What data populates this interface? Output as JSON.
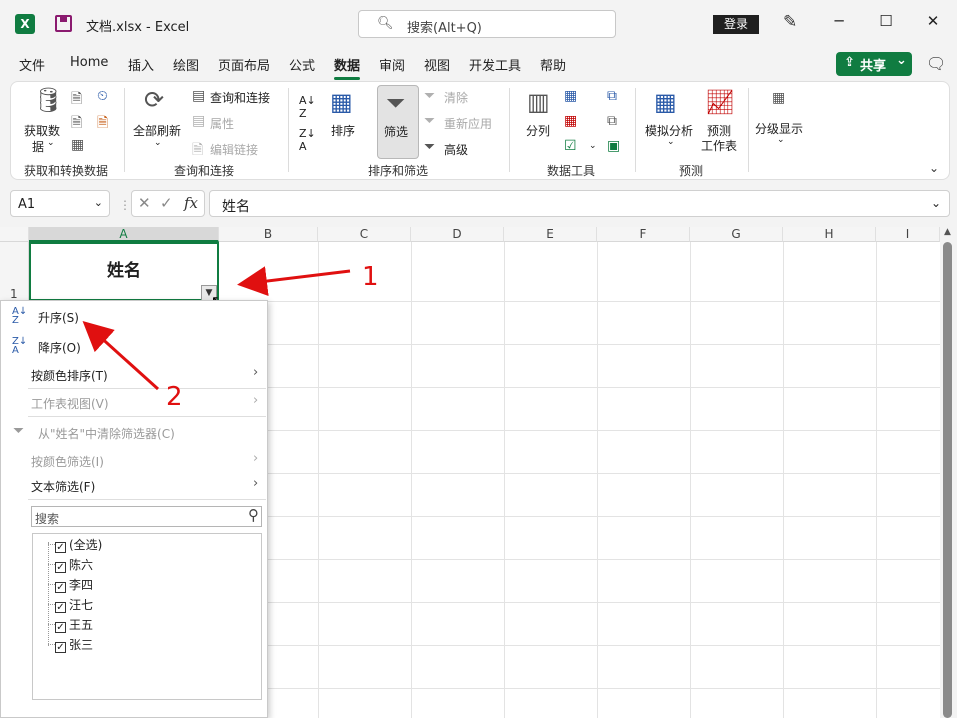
{
  "titlebar": {
    "app_icon": "X",
    "doc_title": "文档.xlsx  -  Excel",
    "search_placeholder": "搜索(Alt+Q)",
    "login": "登录",
    "minimize": "─",
    "maximize": "☐",
    "close": "✕"
  },
  "tabs": [
    "文件",
    "Home",
    "插入",
    "绘图",
    "页面布局",
    "公式",
    "数据",
    "审阅",
    "视图",
    "开发工具",
    "帮助"
  ],
  "share": {
    "label": "共享",
    "icon": "⇪",
    "caret": "⌄"
  },
  "ribbon": {
    "get_data": "获取数",
    "get_data2": "据",
    "refresh_all": "全部刷新",
    "query_conn": "查询和连接",
    "properties": "属性",
    "edit_links": "编辑链接",
    "sort": "排序",
    "filter": "筛选",
    "clear": "清除",
    "reapply": "重新应用",
    "advanced": "高级",
    "split": "分列",
    "whatif": "模拟分析",
    "forecast1": "预测",
    "forecast2": "工作表",
    "outline": "分级显示",
    "groups": {
      "get_transform": "获取和转换数据",
      "queries": "查询和连接",
      "sort_filter": "排序和筛选",
      "data_tools": "数据工具",
      "forecast": "预测"
    }
  },
  "formula_bar": {
    "name_box": "A1",
    "fx": "fx",
    "content": "姓名"
  },
  "grid": {
    "columns": [
      "A",
      "B",
      "C",
      "D",
      "E",
      "F",
      "G",
      "H",
      "I"
    ],
    "row1": "1",
    "a1": "姓名"
  },
  "dropdown": {
    "sort_asc": "升序(S)",
    "sort_desc": "降序(O)",
    "sort_color": "按颜色排序(T)",
    "sheet_view": "工作表视图(V)",
    "clear_filter": "从\"姓名\"中清除筛选器(C)",
    "filter_color": "按颜色筛选(I)",
    "text_filter": "文本筛选(F)",
    "search_placeholder": "搜索",
    "items": [
      "(全选)",
      "陈六",
      "李四",
      "汪七",
      "王五",
      "张三"
    ]
  },
  "annotations": {
    "label1": "1",
    "label2": "2",
    "color": "#e01010"
  }
}
